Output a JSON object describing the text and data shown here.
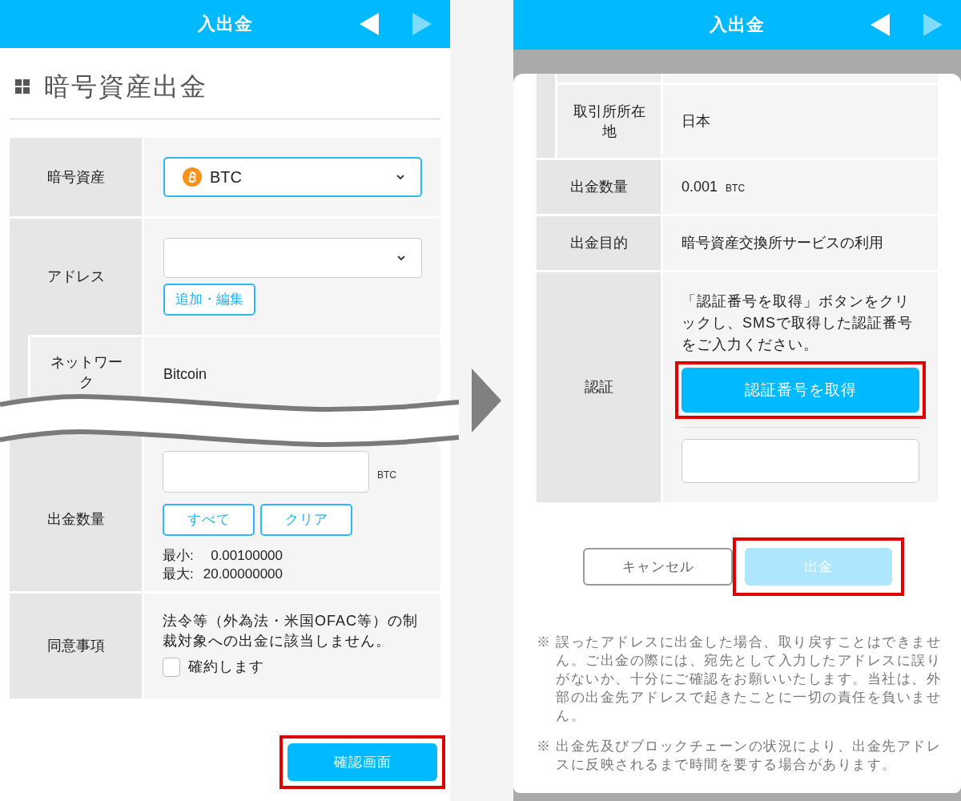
{
  "form_screen": {
    "header": {
      "title": "入出金",
      "back": {
        "disabled": false
      },
      "forward": {
        "disabled": true
      }
    },
    "page_title": "暗号資産出金",
    "rows": [
      {
        "kind": "select",
        "label": "暗号資産",
        "value": "BTC",
        "focused": true
      },
      {
        "kind": "select",
        "label": "アドレス",
        "focused": false,
        "button": "追加・編集",
        "children": [
          {
            "kind": "text",
            "label": "ネットワーク",
            "value": "Bitcoin"
          }
        ]
      },
      {
        "kind": "amount",
        "label": "出金数量",
        "unit": "BTC",
        "buttons": [
          "すべて",
          "クリア"
        ],
        "limits": [
          {
            "label": "最小:",
            "value": "0.00100000"
          },
          {
            "label": "最大:",
            "value": "20.00000000"
          }
        ]
      },
      {
        "kind": "agreement",
        "label": "同意事項",
        "text": "法令等（外為法・米国OFAC等）の制裁対象への出金に該当しません。",
        "checkbox": {
          "label": "確約します",
          "checked": false
        }
      }
    ],
    "submit": {
      "label": "確認画面",
      "highlighted": true
    }
  },
  "confirm_screen": {
    "header": {
      "title": "入出金",
      "back": {
        "disabled": false
      },
      "forward": {
        "disabled": true
      }
    },
    "rows": [
      {
        "kind": "group",
        "children": [
          {
            "kind": "text",
            "label": "取引所所在地",
            "value": "日本"
          }
        ]
      },
      {
        "kind": "text",
        "label": "出金数量",
        "value": "0.001",
        "unit": "BTC"
      },
      {
        "kind": "text",
        "label": "出金目的",
        "value": "暗号資産交換所サービスの利用"
      },
      {
        "kind": "auth",
        "label": "認証",
        "text": "「認証番号を取得」ボタンをクリックし、SMSで取得した認証番号をご入力ください。",
        "button": {
          "label": "認証番号を取得",
          "highlighted": true
        }
      }
    ],
    "buttons": [
      {
        "kind": "cancel",
        "label": "キャンセル",
        "disabled": false,
        "highlighted": false
      },
      {
        "kind": "primary",
        "label": "出金",
        "disabled": true,
        "highlighted": true
      }
    ],
    "notes": [
      {
        "mark": "※",
        "text": "誤ったアドレスに出金した場合、取り戻すことはできません。ご出金の際には、宛先として入力したアドレスに誤りがないか、十分にご確認をお願いいたします。当社は、外部の出金先アドレスで起きたことに一切の責任を負いません。"
      },
      {
        "mark": "※",
        "text": "出金先及びブロックチェーンの状況により、出金先アドレスに反映されるまで時間を要する場合があります。"
      }
    ]
  }
}
